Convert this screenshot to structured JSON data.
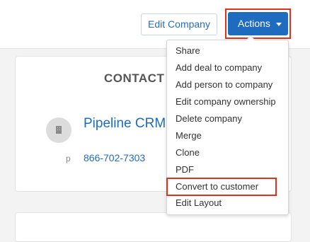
{
  "header": {
    "edit_company_label": "Edit Company",
    "actions_label": "Actions"
  },
  "card": {
    "title": "CONTACT",
    "company_name": "Pipeline CRM",
    "phone_label": "p",
    "phone_value": "866-702-7303"
  },
  "actions_menu": {
    "items": [
      "Share",
      "Add deal to company",
      "Add person to company",
      "Edit company ownership",
      "Delete company",
      "Merge",
      "Clone",
      "PDF",
      "Convert to customer",
      "Edit Layout"
    ]
  },
  "colors": {
    "accent": "#1f6bbf",
    "highlight": "#e0301e"
  },
  "icons": {
    "actions_caret": "caret-down-icon",
    "avatar": "building-icon"
  }
}
